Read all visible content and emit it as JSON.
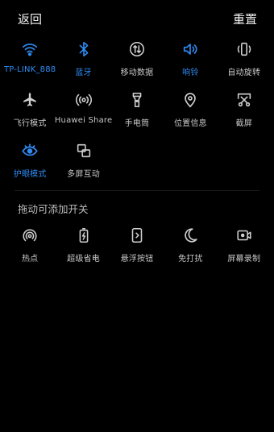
{
  "header": {
    "back_label": "返回",
    "reset_label": "重置"
  },
  "active_tiles": [
    {
      "id": "wifi",
      "icon": "wifi-icon",
      "label": "TP-LINK_888",
      "on": true
    },
    {
      "id": "bluetooth",
      "icon": "bluetooth-icon",
      "label": "蓝牙",
      "on": true
    },
    {
      "id": "mobile-data",
      "icon": "mobile-data-icon",
      "label": "移动数据",
      "on": false
    },
    {
      "id": "ring",
      "icon": "speaker-icon",
      "label": "响铃",
      "on": true
    },
    {
      "id": "auto-rotate",
      "icon": "auto-rotate-icon",
      "label": "自动旋转",
      "on": false
    },
    {
      "id": "airplane",
      "icon": "airplane-icon",
      "label": "飞行模式",
      "on": false
    },
    {
      "id": "huawei-share",
      "icon": "share-icon",
      "label": "Huawei Share",
      "on": false
    },
    {
      "id": "flashlight",
      "icon": "flashlight-icon",
      "label": "手电筒",
      "on": false
    },
    {
      "id": "location",
      "icon": "location-icon",
      "label": "位置信息",
      "on": false
    },
    {
      "id": "screenshot",
      "icon": "screenshot-icon",
      "label": "截屏",
      "on": false
    },
    {
      "id": "eye-comfort",
      "icon": "eye-icon",
      "label": "护眼模式",
      "on": true
    },
    {
      "id": "multi-screen",
      "icon": "multi-screen-icon",
      "label": "多屏互动",
      "on": false
    }
  ],
  "section": {
    "title": "拖动可添加开关"
  },
  "inactive_tiles": [
    {
      "id": "hotspot",
      "icon": "hotspot-icon",
      "label": "热点"
    },
    {
      "id": "power-saver",
      "icon": "battery-icon",
      "label": "超级省电"
    },
    {
      "id": "floating-button",
      "icon": "floating-button-icon",
      "label": "悬浮按钮"
    },
    {
      "id": "do-not-disturb",
      "icon": "moon-icon",
      "label": "免打扰"
    },
    {
      "id": "screen-record",
      "icon": "screen-record-icon",
      "label": "屏幕录制"
    }
  ],
  "colors": {
    "accent": "#2f8cf5",
    "icon": "#d0d0d0",
    "background": "#000000"
  }
}
